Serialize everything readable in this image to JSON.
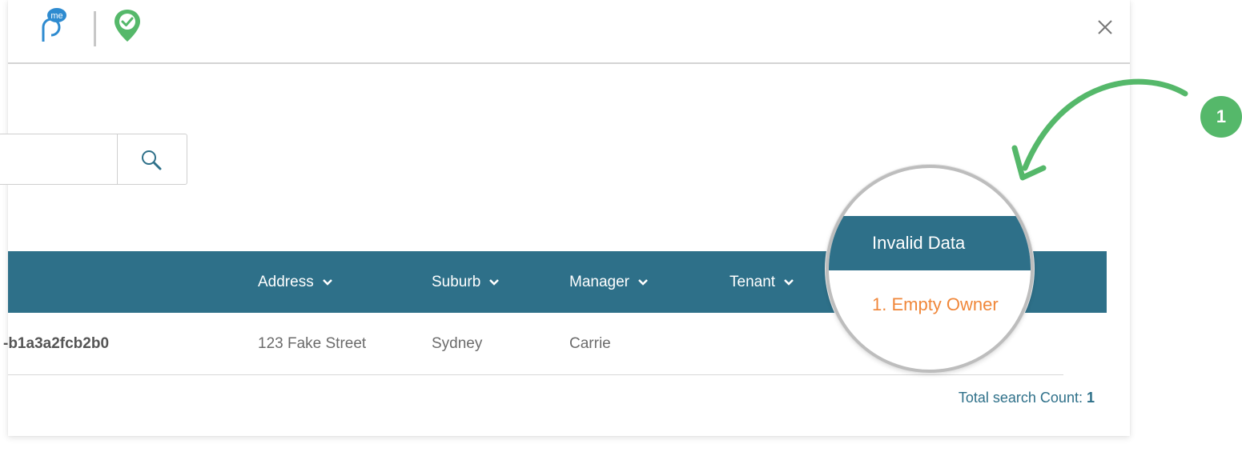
{
  "header": {
    "logo_badge": "me",
    "close_icon": "close-icon"
  },
  "search": {
    "value": "",
    "button_icon": "search-icon"
  },
  "table": {
    "columns": [
      {
        "label": "Address"
      },
      {
        "label": "Suburb"
      },
      {
        "label": "Manager"
      },
      {
        "label": "Tenant"
      }
    ],
    "rows": [
      {
        "id": "-b1a3a2fcb2b0",
        "address": "123 Fake Street",
        "suburb": "Sydney",
        "manager": "Carrie",
        "tenant": ""
      }
    ]
  },
  "footer": {
    "total_label": "Total search Count:",
    "total_value": "1"
  },
  "callout": {
    "header": "Invalid Data",
    "item": "1. Empty Owner",
    "badge_number": "1",
    "accent": "#2e7089",
    "warning_color": "#f0873a",
    "badge_color": "#55b86a"
  }
}
